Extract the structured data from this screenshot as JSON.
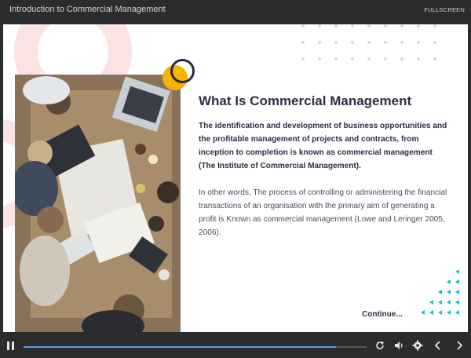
{
  "header": {
    "course_title": "Introduction to Commercial Management",
    "fullscreen_label": "FULLSCREEN"
  },
  "slide": {
    "heading": "What Is Commercial Management",
    "definition": "The identification and development of business opportunities and the profitable management of projects and contracts, from inception to completion is known as commercial management (The Institute of Commercial Management).",
    "alternative": "In other words, The process of controlling or administering the financial transactions of an organisation with the primary aim of generating a profit is Known as commercial management (Lowe and Leringer 2005, 2006).",
    "continue_label": "Continue..."
  },
  "player": {
    "progress": 0.91,
    "icons": [
      "pause-icon",
      "replay-icon",
      "volume-icon",
      "settings-icon",
      "previous-icon",
      "next-icon"
    ]
  },
  "colors": {
    "accent_yellow": "#f4b400",
    "accent_teal": "#1bbfc4",
    "progress_blue": "#5aa0f0",
    "heading_navy": "#2c2e44",
    "deco_pink": "#fbe3e4"
  }
}
